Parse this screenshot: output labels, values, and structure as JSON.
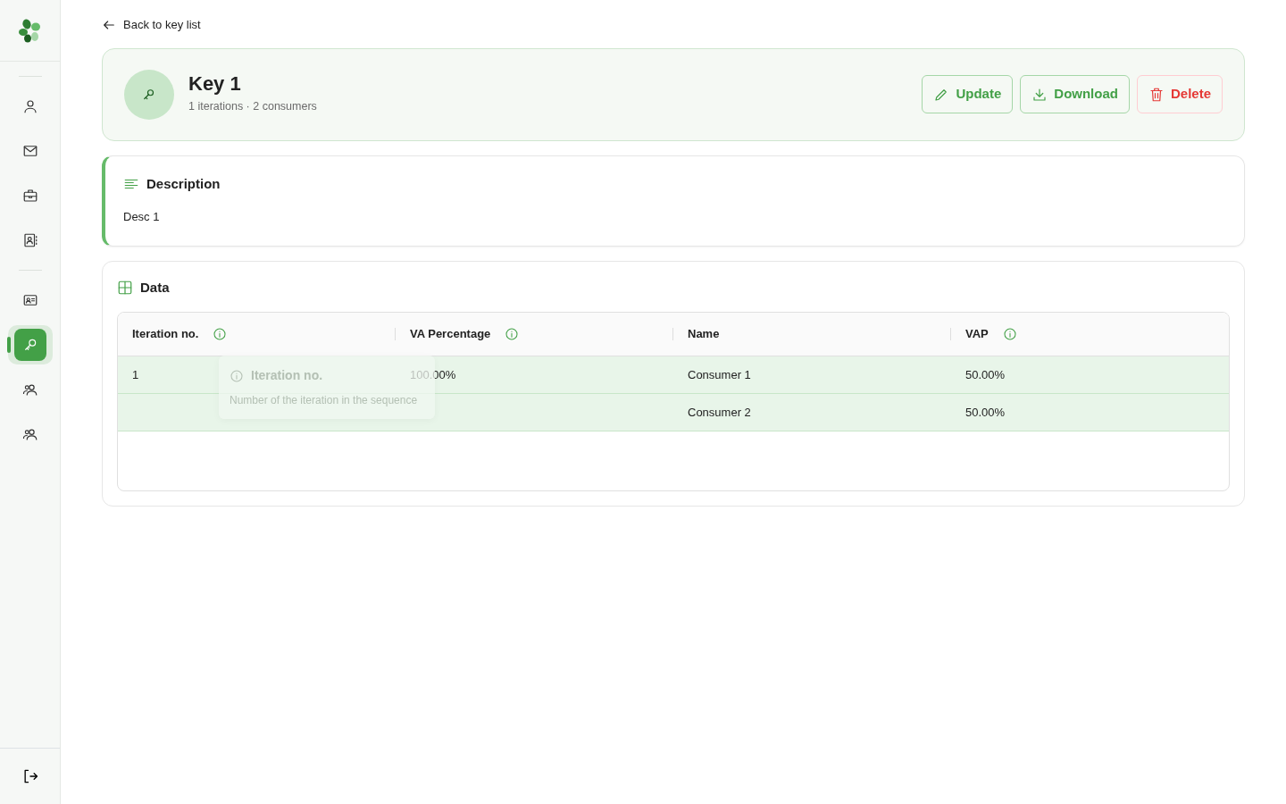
{
  "sidebar": {
    "items": [
      {
        "selected": false
      },
      {
        "selected": false
      },
      {
        "selected": false
      },
      {
        "selected": false
      },
      {
        "selected": false
      },
      {
        "selected": true
      },
      {
        "selected": false
      },
      {
        "selected": false
      }
    ]
  },
  "back_link": "Back to key list",
  "header": {
    "title": "Key 1",
    "subtitle": "1 iterations · 2 consumers",
    "buttons": [
      {
        "label": "Update",
        "kind": "edit"
      },
      {
        "label": "Download",
        "kind": "download"
      },
      {
        "label": "Delete",
        "kind": "delete"
      }
    ]
  },
  "description": {
    "title": "Description",
    "text": "Desc 1"
  },
  "data": {
    "title": "Data",
    "table": {
      "columns": [
        {
          "label": "Iteration no.",
          "info": true
        },
        {
          "label": "VA Percentage",
          "info": true
        },
        {
          "label": "Name",
          "info": false
        },
        {
          "label": "VAP",
          "info": true
        }
      ],
      "rows": [
        {
          "cells": [
            "1",
            "100.00%",
            "Consumer 1",
            "50.00%"
          ]
        },
        {
          "cells": [
            "",
            "",
            "Consumer 2",
            "50.00%"
          ]
        }
      ]
    },
    "tooltip": {
      "title": "Iteration no.",
      "text": "Number of the iteration in the sequence"
    }
  }
}
